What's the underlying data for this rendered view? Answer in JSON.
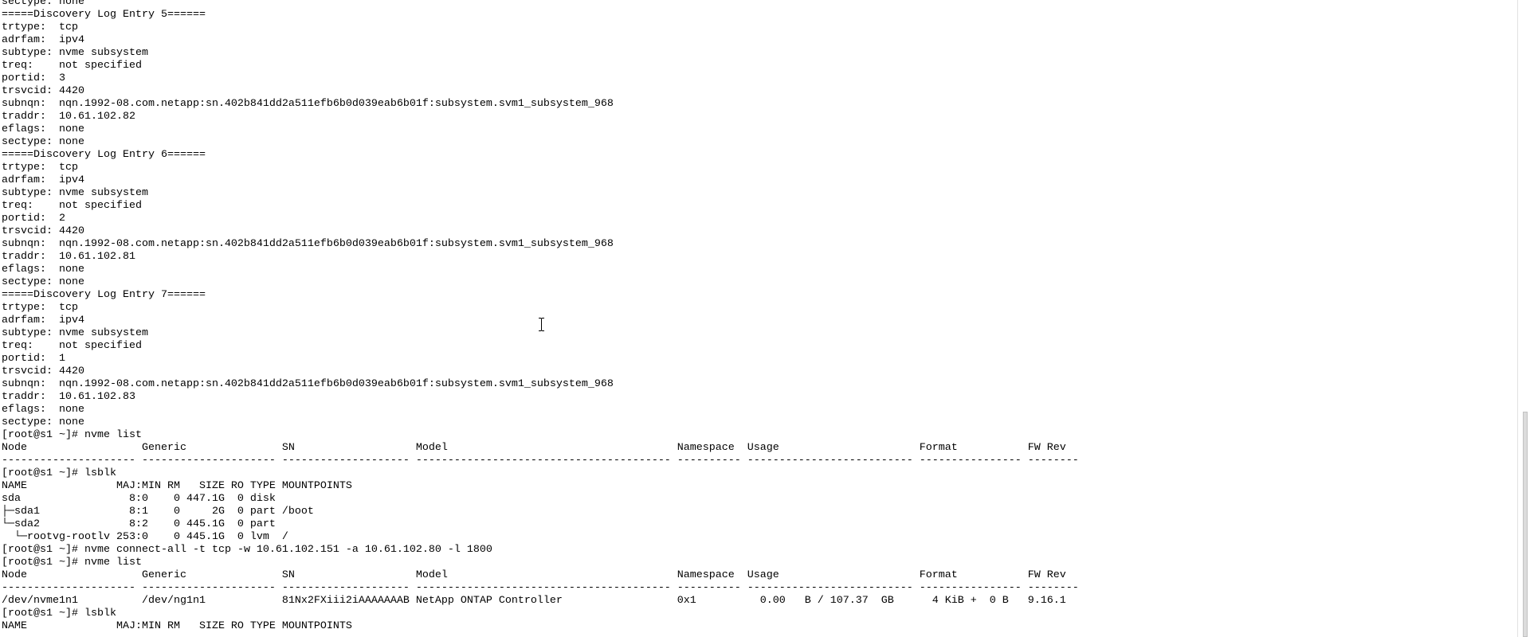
{
  "terminal": {
    "lines": [
      {
        "text": "sectype: none"
      },
      {
        "text": "=====Discovery Log Entry 5======"
      },
      {
        "text": "trtype:  tcp"
      },
      {
        "text": "adrfam:  ipv4"
      },
      {
        "text": "subtype: nvme subsystem"
      },
      {
        "text": "treq:    not specified"
      },
      {
        "text": "portid:  3"
      },
      {
        "text": "trsvcid: 4420"
      },
      {
        "text": "subnqn:  nqn.1992-08.com.netapp:sn.402b841dd2a511efb6b0d039eab6b01f:subsystem.svm1_subsystem_968"
      },
      {
        "text": "traddr:  10.61.102.82"
      },
      {
        "text": "eflags:  none"
      },
      {
        "text": "sectype: none"
      },
      {
        "text": "=====Discovery Log Entry 6======"
      },
      {
        "text": "trtype:  tcp"
      },
      {
        "text": "adrfam:  ipv4"
      },
      {
        "text": "subtype: nvme subsystem"
      },
      {
        "text": "treq:    not specified"
      },
      {
        "text": "portid:  2"
      },
      {
        "text": "trsvcid: 4420"
      },
      {
        "text": "subnqn:  nqn.1992-08.com.netapp:sn.402b841dd2a511efb6b0d039eab6b01f:subsystem.svm1_subsystem_968"
      },
      {
        "text": "traddr:  10.61.102.81"
      },
      {
        "text": "eflags:  none"
      },
      {
        "text": "sectype: none"
      },
      {
        "text": "=====Discovery Log Entry 7======"
      },
      {
        "text": "trtype:  tcp"
      },
      {
        "text": "adrfam:  ipv4"
      },
      {
        "text": "subtype: nvme subsystem"
      },
      {
        "text": "treq:    not specified"
      },
      {
        "text": "portid:  1"
      },
      {
        "text": "trsvcid: 4420"
      },
      {
        "text": "subnqn:  nqn.1992-08.com.netapp:sn.402b841dd2a511efb6b0d039eab6b01f:subsystem.svm1_subsystem_968"
      },
      {
        "text": "traddr:  10.61.102.83"
      },
      {
        "text": "eflags:  none"
      },
      {
        "text": "sectype: none"
      },
      {
        "prompt": "[root@s1 ~]# ",
        "command": "nvme list"
      },
      {
        "text": "Node                  Generic               SN                   Model                                    Namespace  Usage                      Format           FW Rev"
      },
      {
        "text": "--------------------- --------------------- -------------------- ---------------------------------------- ---------- -------------------------- ---------------- --------"
      },
      {
        "prompt": "[root@s1 ~]# ",
        "command": "lsblk"
      },
      {
        "text": "NAME              MAJ:MIN RM   SIZE RO TYPE MOUNTPOINTS"
      },
      {
        "text": "sda                 8:0    0 447.1G  0 disk"
      },
      {
        "text": "├─sda1              8:1    0     2G  0 part /boot"
      },
      {
        "text": "└─sda2              8:2    0 445.1G  0 part"
      },
      {
        "text": "  └─rootvg-rootlv 253:0    0 445.1G  0 lvm  /"
      },
      {
        "prompt": "[root@s1 ~]# ",
        "command": "nvme connect-all -t tcp -w 10.61.102.151 -a 10.61.102.80 -l 1800"
      },
      {
        "prompt": "[root@s1 ~]# ",
        "command": "nvme list"
      },
      {
        "text": "Node                  Generic               SN                   Model                                    Namespace  Usage                      Format           FW Rev"
      },
      {
        "text": "--------------------- --------------------- -------------------- ---------------------------------------- ---------- -------------------------- ---------------- --------"
      },
      {
        "text": "/dev/nvme1n1          /dev/ng1n1            81Nx2FXiii2iAAAAAAAB NetApp ONTAP Controller                  0x1          0.00   B / 107.37  GB      4 KiB +  0 B   9.16.1"
      },
      {
        "prompt": "[root@s1 ~]# ",
        "command": "lsblk"
      },
      {
        "text": "NAME              MAJ:MIN RM   SIZE RO TYPE MOUNTPOINTS"
      }
    ]
  },
  "scrollbar": {
    "position": 1.0,
    "visible_fraction": 0.354
  },
  "cursor": {
    "icon": "ibeam-cursor-icon"
  },
  "colors": {
    "terminal_background": "#ffffff",
    "terminal_text": "#000000",
    "scrollbar_thumb": "#dcdcdc"
  }
}
